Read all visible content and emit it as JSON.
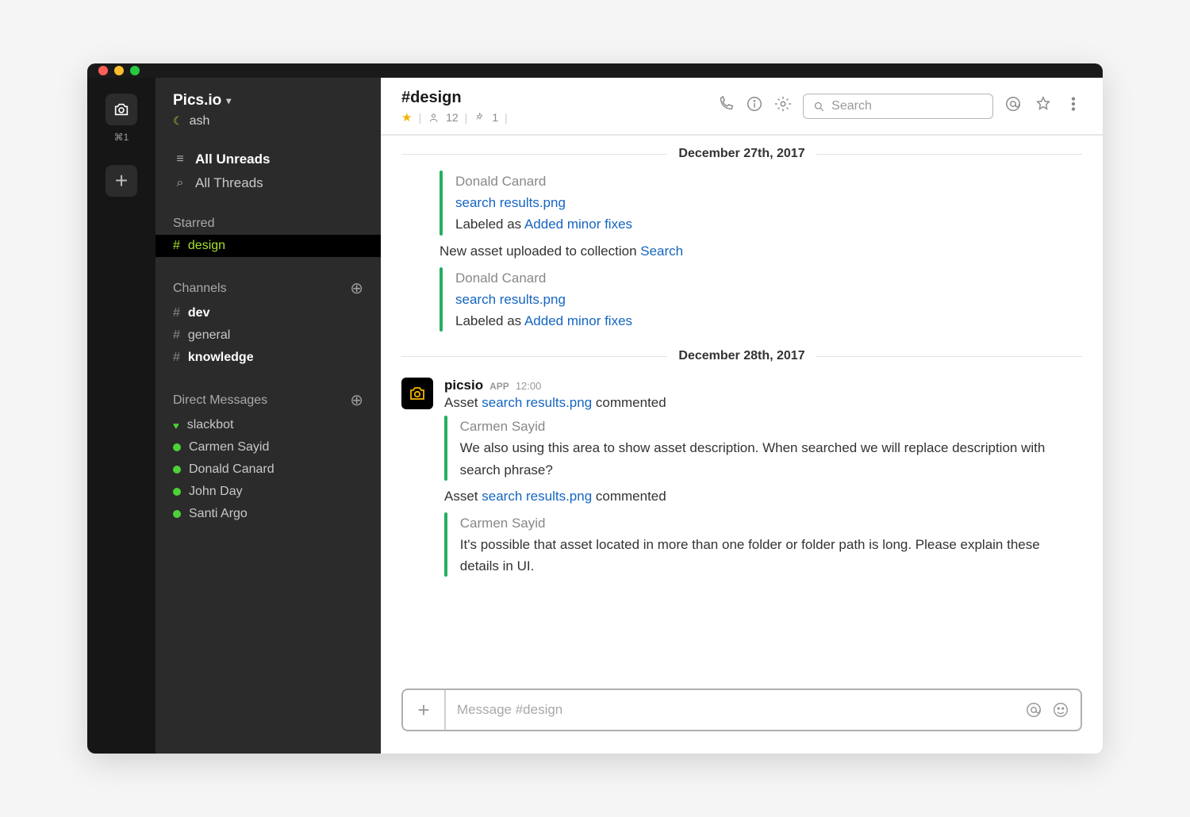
{
  "workspace": {
    "name": "Pics.io",
    "shortcut": "⌘1",
    "user": "ash"
  },
  "sidebar": {
    "allUnreads": "All Unreads",
    "allThreads": "All Threads",
    "starredHeader": "Starred",
    "starred": [
      {
        "name": "design"
      }
    ],
    "channelsHeader": "Channels",
    "channels": [
      {
        "name": "dev",
        "bold": true
      },
      {
        "name": "general",
        "bold": false
      },
      {
        "name": "knowledge",
        "bold": true
      }
    ],
    "dmHeader": "Direct Messages",
    "dms": [
      {
        "name": "slackbot",
        "heart": true
      },
      {
        "name": "Carmen Sayid"
      },
      {
        "name": "Donald Canard"
      },
      {
        "name": "John Day"
      },
      {
        "name": "Santi Argo"
      }
    ]
  },
  "header": {
    "channel": "#design",
    "members": "12",
    "pins": "1",
    "searchPlaceholder": "Search"
  },
  "dates": {
    "d1": "December 27th, 2017",
    "d2": "December 28th, 2017"
  },
  "blocks": {
    "a1_author": "Donald Canard",
    "a1_file": "search results.png",
    "a1_label_prefix": "Labeled as ",
    "a1_label_link": "Added minor fixes",
    "sys1_prefix": "New asset uploaded to collection ",
    "sys1_link": "Search",
    "a2_author": "Donald Canard",
    "a2_file": "search results.png",
    "a2_label_prefix": "Labeled as ",
    "a2_label_link": "Added minor fixes"
  },
  "msg": {
    "name": "picsio",
    "badge": "APP",
    "time": "12:00",
    "l1_prefix": "Asset ",
    "l1_link": "search results.png",
    "l1_suffix": " commented",
    "c1_author": "Carmen Sayid",
    "c1_text": "We also using this area to show asset description. When searched we will replace description with search phrase?",
    "l2_prefix": "Asset ",
    "l2_link": "search results.png",
    "l2_suffix": " commented",
    "c2_author": "Carmen Sayid",
    "c2_text": "It's possible that asset located in more than one folder or folder path is long. Please explain these details in UI."
  },
  "composer": {
    "placeholder": "Message #design"
  }
}
